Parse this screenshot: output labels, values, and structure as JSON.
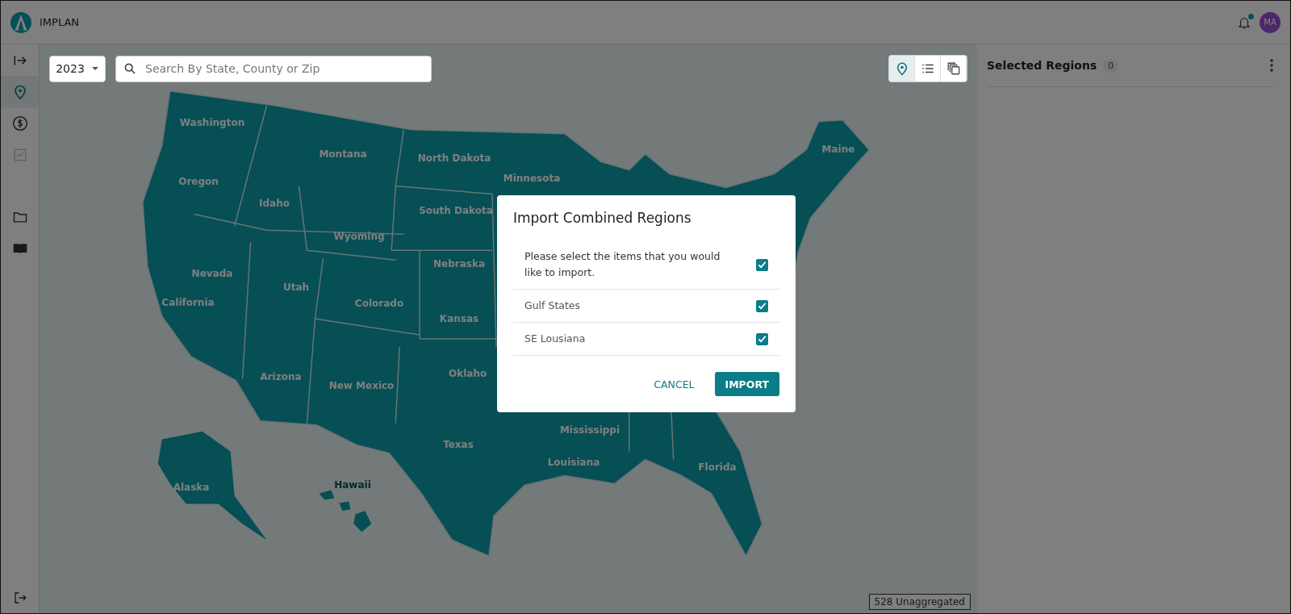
{
  "header": {
    "brand": "IMPLAN",
    "notification_dot": true,
    "avatar": "MA"
  },
  "sidebar": {
    "items": [
      {
        "kind": "expand",
        "selected": false,
        "disabled": false
      },
      {
        "kind": "pin",
        "selected": true,
        "disabled": false
      },
      {
        "kind": "dollar",
        "selected": false,
        "disabled": false
      },
      {
        "kind": "chart",
        "selected": false,
        "disabled": true
      },
      {
        "kind": "folder",
        "selected": false,
        "disabled": false
      },
      {
        "kind": "book",
        "selected": false,
        "disabled": false
      }
    ],
    "logout": {
      "kind": "logout"
    }
  },
  "toolbar": {
    "year": "2023",
    "search": {
      "placeholder": "Search By State, County or Zip"
    },
    "view_buttons": [
      {
        "kind": "map",
        "selected": true
      },
      {
        "kind": "list",
        "selected": false
      },
      {
        "kind": "layers",
        "selected": false
      }
    ]
  },
  "map": {
    "labels": [
      "Washington",
      "Montana",
      "North Dakota",
      "Maine",
      "Minnesota",
      "Oregon",
      "Idaho",
      "South Dakota",
      "Wyoming",
      "Nevada",
      "Nebraska",
      "Utah",
      "Colorado",
      "California",
      "Kansas",
      "Arizona",
      "New Mexico",
      "Oklaho",
      "Texas",
      "Mississippi",
      "Louisiana",
      "Florida",
      "Alaska",
      "Hawaii"
    ],
    "status_tag": "528 Unaggregated"
  },
  "right_panel": {
    "title": "Selected Regions",
    "count": "0"
  },
  "dialog": {
    "title": "Import Combined Regions",
    "rows": [
      {
        "kind": "select_all",
        "label": "Please select the items that you would like to import.",
        "checked": true
      },
      {
        "kind": "item",
        "label": "Gulf States",
        "checked": true
      },
      {
        "kind": "item",
        "label": "SE Lousiana",
        "checked": true
      }
    ],
    "buttons": [
      {
        "kind": "text",
        "label": "CANCEL"
      },
      {
        "kind": "primary",
        "label": "IMPORT"
      }
    ]
  }
}
